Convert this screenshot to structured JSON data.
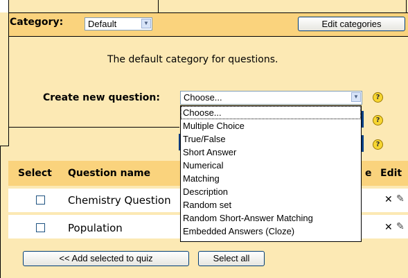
{
  "category": {
    "label": "Category:",
    "selected": "Default",
    "edit_button": "Edit categories"
  },
  "description": "The default category for questions.",
  "create_question": {
    "label": "Create new question:",
    "selected": "Choose...",
    "options": [
      "Choose...",
      "Multiple Choice",
      "True/False",
      "Short Answer",
      "Numerical",
      "Matching",
      "Description",
      "Random set",
      "Random Short-Answer Matching",
      "Embedded Answers (Cloze)"
    ]
  },
  "table": {
    "headers": {
      "select": "Select",
      "name": "Question name",
      "type_fragment": "e",
      "edit": "Edit"
    },
    "rows": [
      {
        "name": "Chemistry Question"
      },
      {
        "name": "Population"
      }
    ]
  },
  "footer": {
    "add_button": "<< Add selected to quiz",
    "select_all_button": "Select all"
  },
  "colors": {
    "panel_bg": "#fce9b4",
    "header_bg": "#fad37d",
    "row_bg": "#ffffff",
    "selected_blue": "#083f84"
  }
}
